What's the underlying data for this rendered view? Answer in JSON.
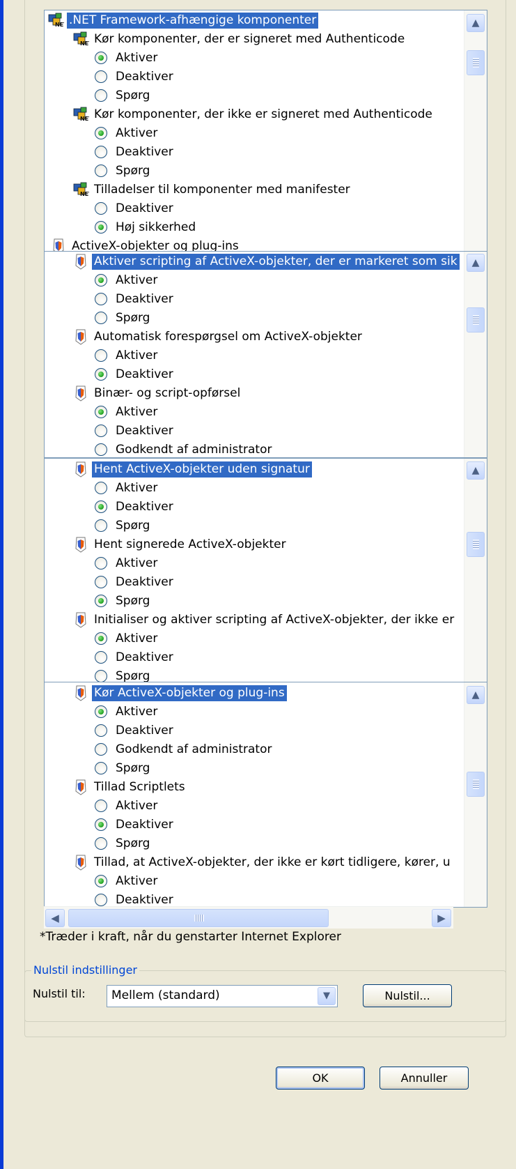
{
  "panes": [
    {
      "rows": [
        {
          "kind": "header",
          "icon": "net-component-icon",
          "label": ".NET Framework-afhængige komponenter",
          "selected": true
        },
        {
          "kind": "setting",
          "icon": "net-component-icon",
          "label": "Kør komponenter, der er signeret med Authenticode"
        },
        {
          "kind": "option",
          "label": "Aktiver",
          "checked": true
        },
        {
          "kind": "option",
          "label": "Deaktiver",
          "checked": false
        },
        {
          "kind": "option",
          "label": "Spørg",
          "checked": false
        },
        {
          "kind": "setting",
          "icon": "net-component-icon",
          "label": "Kør komponenter, der ikke er signeret med Authenticode"
        },
        {
          "kind": "option",
          "label": "Aktiver",
          "checked": true
        },
        {
          "kind": "option",
          "label": "Deaktiver",
          "checked": false
        },
        {
          "kind": "option",
          "label": "Spørg",
          "checked": false
        },
        {
          "kind": "setting",
          "icon": "net-component-icon",
          "label": "Tilladelser til komponenter med manifester"
        },
        {
          "kind": "option",
          "label": "Deaktiver",
          "checked": false
        },
        {
          "kind": "option",
          "label": "Høj sikkerhed",
          "checked": true
        },
        {
          "kind": "header",
          "icon": "shield-icon",
          "label": "ActiveX-objekter og plug-ins",
          "selected": false
        }
      ]
    },
    {
      "rows": [
        {
          "kind": "setting",
          "icon": "shield-icon",
          "label": "Aktiver scripting af ActiveX-objekter, der er markeret som sik",
          "selected": true
        },
        {
          "kind": "option",
          "label": "Aktiver",
          "checked": true
        },
        {
          "kind": "option",
          "label": "Deaktiver",
          "checked": false
        },
        {
          "kind": "option",
          "label": "Spørg",
          "checked": false
        },
        {
          "kind": "setting",
          "icon": "shield-icon",
          "label": "Automatisk forespørgsel om ActiveX-objekter"
        },
        {
          "kind": "option",
          "label": "Aktiver",
          "checked": false
        },
        {
          "kind": "option",
          "label": "Deaktiver",
          "checked": true
        },
        {
          "kind": "setting",
          "icon": "shield-icon",
          "label": "Binær- og script-opførsel"
        },
        {
          "kind": "option",
          "label": "Aktiver",
          "checked": true
        },
        {
          "kind": "option",
          "label": "Deaktiver",
          "checked": false
        },
        {
          "kind": "option",
          "label": "Godkendt af administrator",
          "checked": false
        }
      ]
    },
    {
      "rows": [
        {
          "kind": "setting",
          "icon": "shield-icon",
          "label": "Hent ActiveX-objekter uden signatur",
          "selected": true
        },
        {
          "kind": "option",
          "label": "Aktiver",
          "checked": false
        },
        {
          "kind": "option",
          "label": "Deaktiver",
          "checked": true
        },
        {
          "kind": "option",
          "label": "Spørg",
          "checked": false
        },
        {
          "kind": "setting",
          "icon": "shield-icon",
          "label": "Hent signerede ActiveX-objekter"
        },
        {
          "kind": "option",
          "label": "Aktiver",
          "checked": false
        },
        {
          "kind": "option",
          "label": "Deaktiver",
          "checked": false
        },
        {
          "kind": "option",
          "label": "Spørg",
          "checked": true
        },
        {
          "kind": "setting",
          "icon": "shield-icon",
          "label": "Initialiser og aktiver scripting af ActiveX-objekter, der ikke er"
        },
        {
          "kind": "option",
          "label": "Aktiver",
          "checked": true
        },
        {
          "kind": "option",
          "label": "Deaktiver",
          "checked": false
        },
        {
          "kind": "option",
          "label": "Spørg",
          "checked": false
        }
      ]
    },
    {
      "rows": [
        {
          "kind": "setting",
          "icon": "shield-icon",
          "label": "Kør ActiveX-objekter og plug-ins",
          "selected": true
        },
        {
          "kind": "option",
          "label": "Aktiver",
          "checked": true
        },
        {
          "kind": "option",
          "label": "Deaktiver",
          "checked": false
        },
        {
          "kind": "option",
          "label": "Godkendt af administrator",
          "checked": false
        },
        {
          "kind": "option",
          "label": "Spørg",
          "checked": false
        },
        {
          "kind": "setting",
          "icon": "shield-icon",
          "label": "Tillad Scriptlets"
        },
        {
          "kind": "option",
          "label": "Aktiver",
          "checked": false
        },
        {
          "kind": "option",
          "label": "Deaktiver",
          "checked": true
        },
        {
          "kind": "option",
          "label": "Spørg",
          "checked": false
        },
        {
          "kind": "setting",
          "icon": "shield-icon",
          "label": "Tillad, at ActiveX-objekter, der ikke er kørt tidligere, kører, u"
        },
        {
          "kind": "option",
          "label": "Aktiver",
          "checked": true
        },
        {
          "kind": "option",
          "label": "Deaktiver",
          "checked": false
        }
      ]
    }
  ],
  "footnote": "*Træder i kraft, når du genstarter Internet Explorer",
  "reset": {
    "group_label": "Nulstil indstillinger",
    "to_label": "Nulstil til:",
    "selected_level": "Mellem (standard)",
    "reset_button": "Nulstil..."
  },
  "buttons": {
    "ok": "OK",
    "cancel": "Annuller"
  },
  "colors": {
    "selection": "#316ac5",
    "frame_blue": "#0a3bd6",
    "dialog_bg": "#ece9d8",
    "group_label": "#0046d5"
  }
}
